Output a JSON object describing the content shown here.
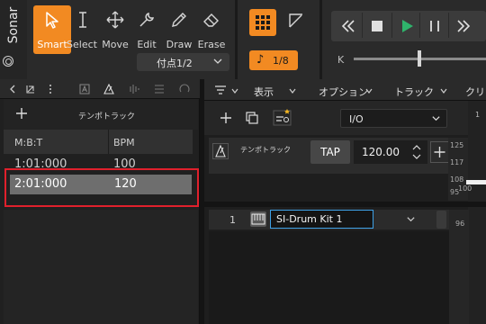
{
  "app": {
    "brand": "Sonar"
  },
  "toolbar": {
    "tools": [
      {
        "label": "Smart",
        "icon": "smart-arrow-icon",
        "active": true
      },
      {
        "label": "Select",
        "icon": "text-cursor-icon"
      },
      {
        "label": "Move",
        "icon": "move-arrows-icon"
      },
      {
        "label": "Edit",
        "icon": "wrench-icon"
      },
      {
        "label": "Draw",
        "icon": "pencil-icon"
      },
      {
        "label": "Erase",
        "icon": "eraser-icon"
      }
    ],
    "snap_value": "付点1/2",
    "note_value": "1/8",
    "note_symbol": "♪",
    "accent_color": "#f28a22",
    "scrub_label": "K"
  },
  "transport": {
    "buttons": [
      "rewind-icon",
      "stop-icon",
      "play-icon",
      "pause-icon",
      "fast-forward-icon"
    ],
    "play_color": "#2fb36b"
  },
  "tempo_view": {
    "title": "テンポトラック",
    "columns": [
      "M:B:T",
      "BPM"
    ],
    "rows": [
      {
        "mbt": "1:01:000",
        "bpm": "100"
      },
      {
        "mbt": "2:01:000",
        "bpm": "120",
        "selected": true
      }
    ],
    "highlight_color": "#e0202c"
  },
  "track_view": {
    "menus": [
      "表示",
      "オプション",
      "トラック",
      "クリッ"
    ],
    "io_value": "I/O",
    "tempo_track": {
      "name": "テンポトラック",
      "tap_label": "TAP",
      "tempo": "120.00",
      "scale": [
        "125",
        "117",
        "108",
        "100",
        "95"
      ]
    },
    "ruler_tick": "1",
    "track": {
      "number": "1",
      "name": "SI-Drum Kit 1",
      "scale": "96"
    }
  }
}
